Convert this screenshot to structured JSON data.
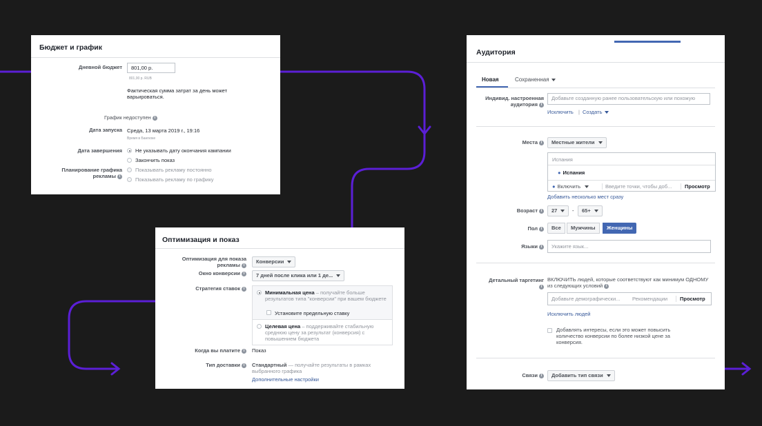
{
  "budget": {
    "title": "Бюджет и график",
    "daily_budget_label": "Дневной бюджет",
    "daily_budget_value": "801,00 р.",
    "daily_budget_sub": "801,00 р. RUB",
    "actual_spend_note": "Фактическая сумма затрат за день может варьироваться.",
    "schedule_unavailable": "График недоступен",
    "start_label": "Дата запуска",
    "start_value": "Среда, 13 марта 2019 г., 19:16",
    "start_tz": "Время в Бангкоке",
    "end_label": "Дата завершения",
    "end_opt1": "Не указывать дату окончания кампании",
    "end_opt2": "Закончить показ",
    "ad_schedule_label": "Планирование графика рекламы",
    "sched_opt1": "Показывать рекламу постоянно",
    "sched_opt2": "Показывать рекламу по графику"
  },
  "optimization": {
    "title": "Оптимизация и показ",
    "opt_label": "Оптимизация для показа рекламы",
    "opt_value": "Конверсии",
    "window_label": "Окно конверсии",
    "window_value": "7 дней после клика или 1 де...",
    "bid_label": "Стратегия ставок",
    "bid_opt1_title": "Минимальная цена",
    "bid_opt1_desc": " – получайте больше результатов типа \"конверсии\" при вашем бюджете",
    "bid_cap": "Установите предельную ставку",
    "bid_opt2_title": "Целевая цена",
    "bid_opt2_desc": " – поддерживайте стабильную среднюю цену за результат (конверсия) с повышением бюджета",
    "pay_label": "Когда вы платите",
    "pay_value": "Показ",
    "delivery_label": "Тип доставки",
    "delivery_title": "Стандартный",
    "delivery_desc": " — получайте результаты в рамках выбранного графика",
    "more_settings": "Дополнительные настройки"
  },
  "audience": {
    "title": "Аудитория",
    "tab_new": "Новая",
    "tab_saved": "Сохраненная",
    "custom_label": "Индивид. настроенная аудитория",
    "custom_placeholder": "Добавьте созданную ранее пользовательскую или похожую",
    "exclude": "Исключить",
    "create": "Создать",
    "places_label": "Места",
    "places_value": "Местные жители",
    "loc_group": "Испания",
    "loc_item": "Испания",
    "include_value": "Включить",
    "points_placeholder": "Введите точки, чтобы доб...",
    "browse": "Просмотр",
    "add_many": "Добавить несколько мест сразу",
    "age_label": "Возраст",
    "age_from": "27",
    "age_dash": "-",
    "age_to": "65+",
    "gender_label": "Пол",
    "gender_all": "Все",
    "gender_men": "Мужчины",
    "gender_women": "Женщины",
    "lang_label": "Языки",
    "lang_placeholder": "Укажите язык...",
    "detailed_label": "Детальный таргетинг",
    "detailed_desc": "ВКЛЮЧИТЬ людей, которые соответствуют как минимум ОДНОМУ из следующих условий",
    "demo_placeholder": "Добавьте демографически...",
    "recommend": "Рекомендации",
    "browse2": "Просмотр",
    "exclude_people": "Исключить людей",
    "expand_interests": "Добавлять интересы, если это может повысить количество конверсии по более низкой цене за конверсия.",
    "conn_label": "Связи",
    "conn_value": "Добавить тип связи"
  },
  "colors": {
    "flow": "#5b1fd6",
    "accent": "#4267b2",
    "bg": "#1b1b1b"
  }
}
